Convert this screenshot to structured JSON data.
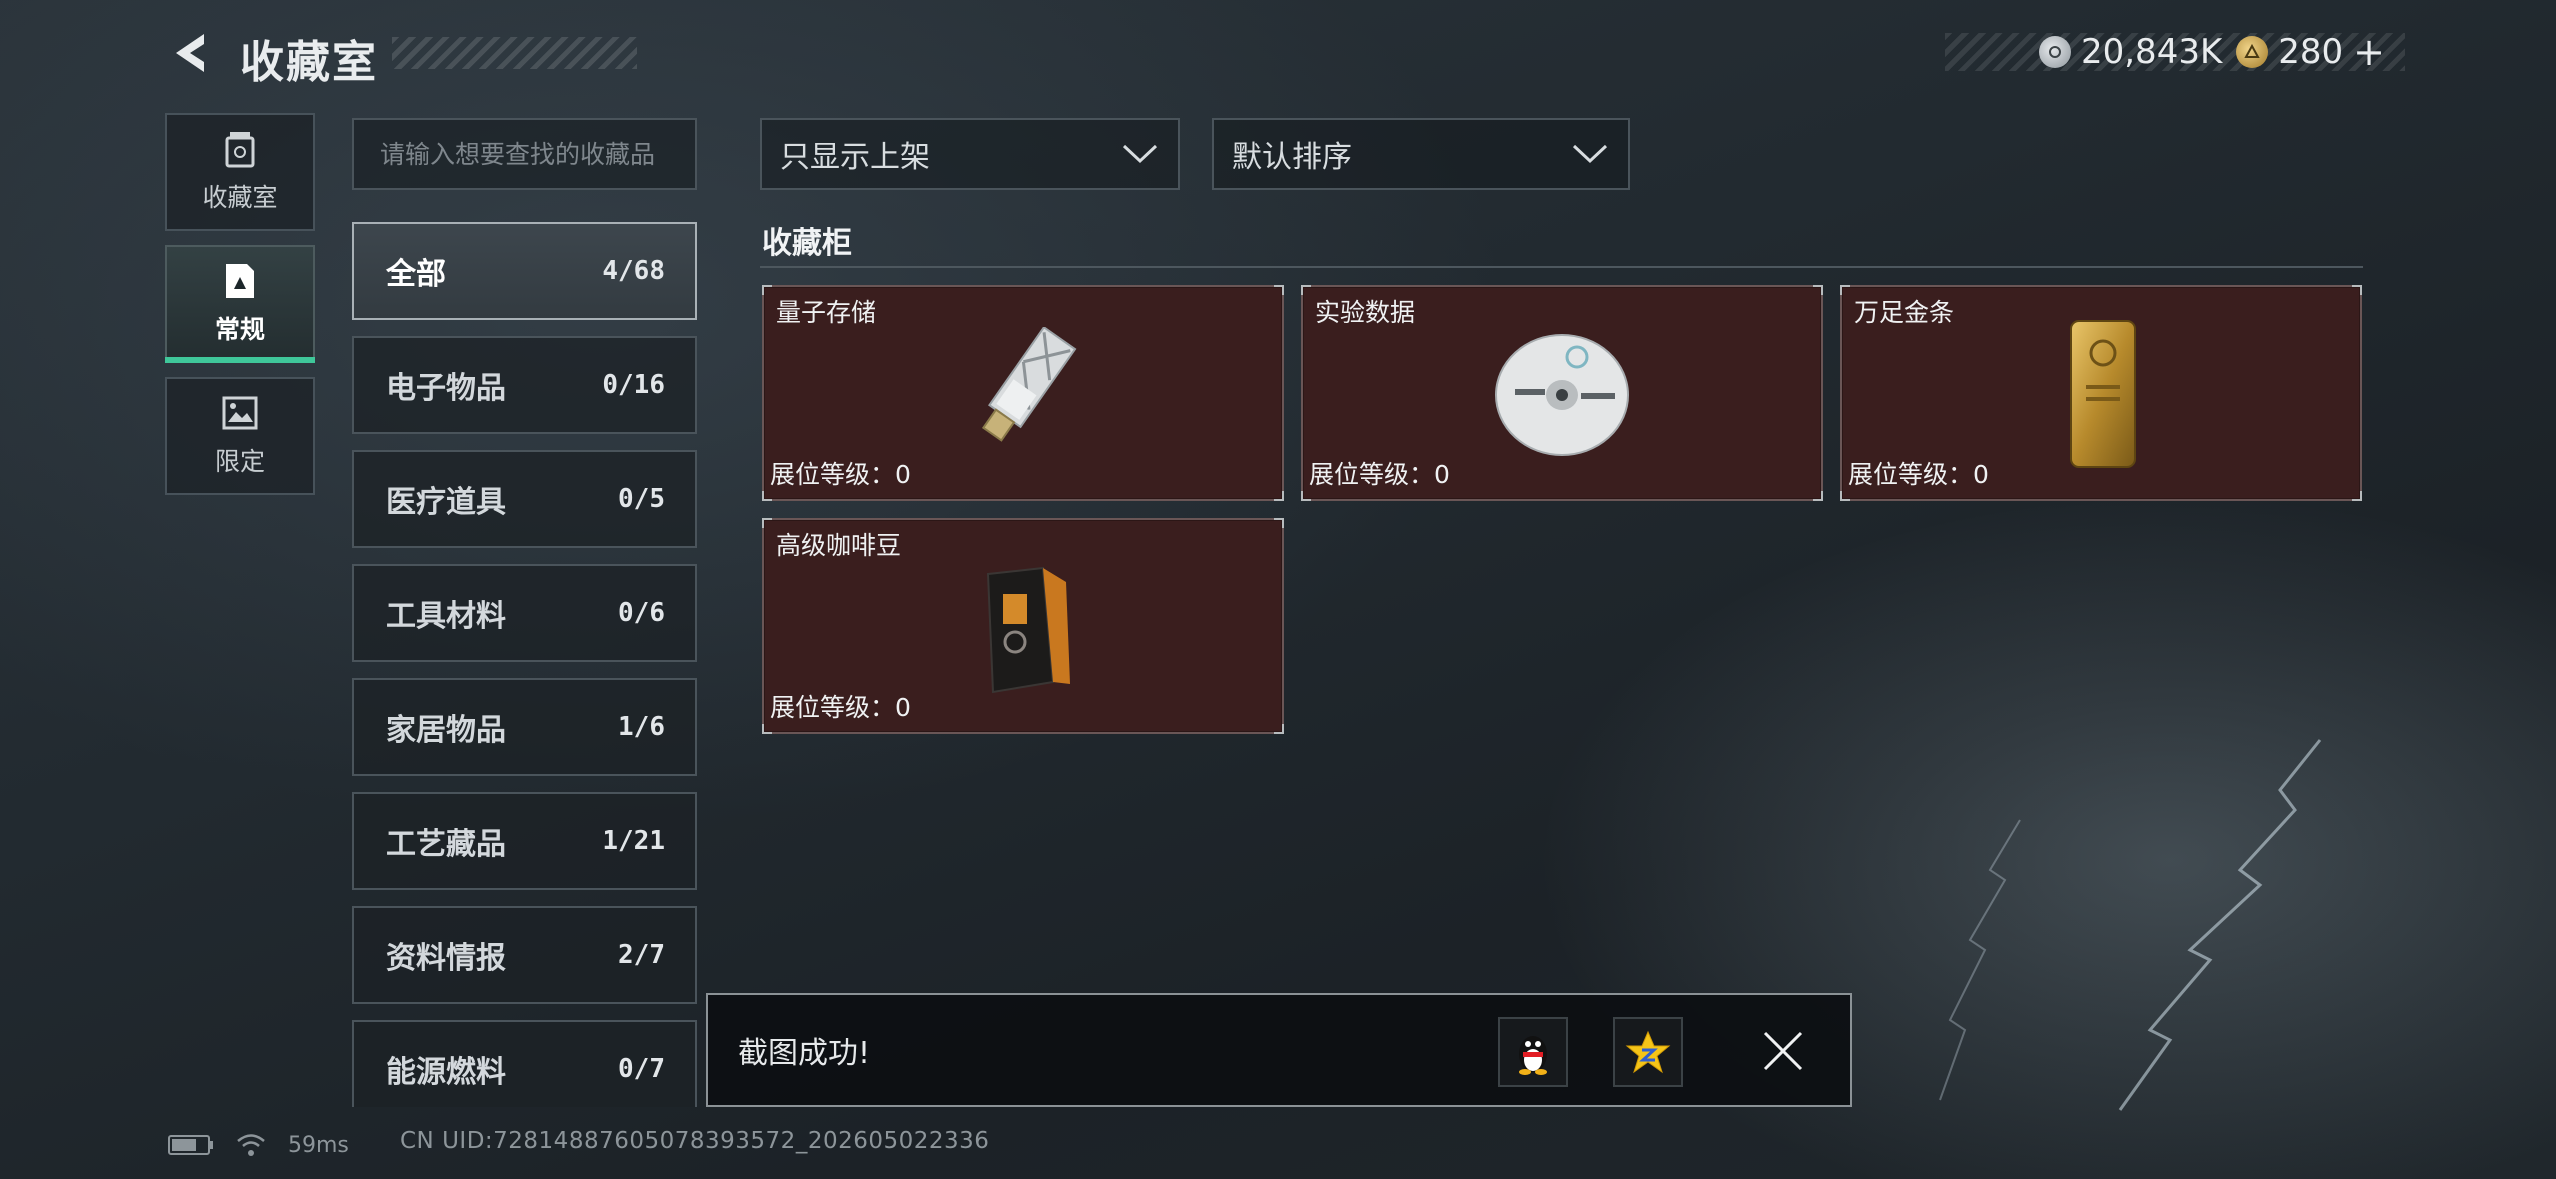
{
  "header": {
    "title": "收藏室",
    "currency_silver": "20,843K",
    "currency_gold": "280",
    "add_symbol": "+"
  },
  "nav": {
    "tabs": [
      {
        "label": "收藏室",
        "icon": "trash-can-icon"
      },
      {
        "label": "常规",
        "icon": "document-icon"
      },
      {
        "label": "限定",
        "icon": "image-icon"
      }
    ]
  },
  "search": {
    "placeholder": "请输入想要查找的收藏品"
  },
  "categories": [
    {
      "label": "全部",
      "count": "4/68"
    },
    {
      "label": "电子物品",
      "count": "0/16"
    },
    {
      "label": "医疗道具",
      "count": "0/5"
    },
    {
      "label": "工具材料",
      "count": "0/6"
    },
    {
      "label": "家居物品",
      "count": "1/6"
    },
    {
      "label": "工艺藏品",
      "count": "1/21"
    },
    {
      "label": "资料情报",
      "count": "2/7"
    },
    {
      "label": "能源燃料",
      "count": "0/7"
    }
  ],
  "filters": {
    "shelf_filter": "只显示上架",
    "sort": "默认排序"
  },
  "section": {
    "title": "收藏柜"
  },
  "items": [
    {
      "name": "量子存储",
      "level_label": "展位等级：",
      "level": "0",
      "icon": "usb-drive-icon"
    },
    {
      "name": "实验数据",
      "level_label": "展位等级：",
      "level": "0",
      "icon": "disc-icon"
    },
    {
      "name": "万足金条",
      "level_label": "展位等级：",
      "level": "0",
      "icon": "gold-bar-icon"
    },
    {
      "name": "高级咖啡豆",
      "level_label": "展位等级：",
      "level": "0",
      "icon": "coffee-bag-icon"
    }
  ],
  "toast": {
    "message": "截图成功!"
  },
  "status": {
    "ping": "59ms",
    "uid": "CN UID:72814887605078393572_202605022336"
  },
  "colors": {
    "accent": "#3fc79a",
    "card_bg": "#3a1e1e",
    "background": "#222a30"
  }
}
